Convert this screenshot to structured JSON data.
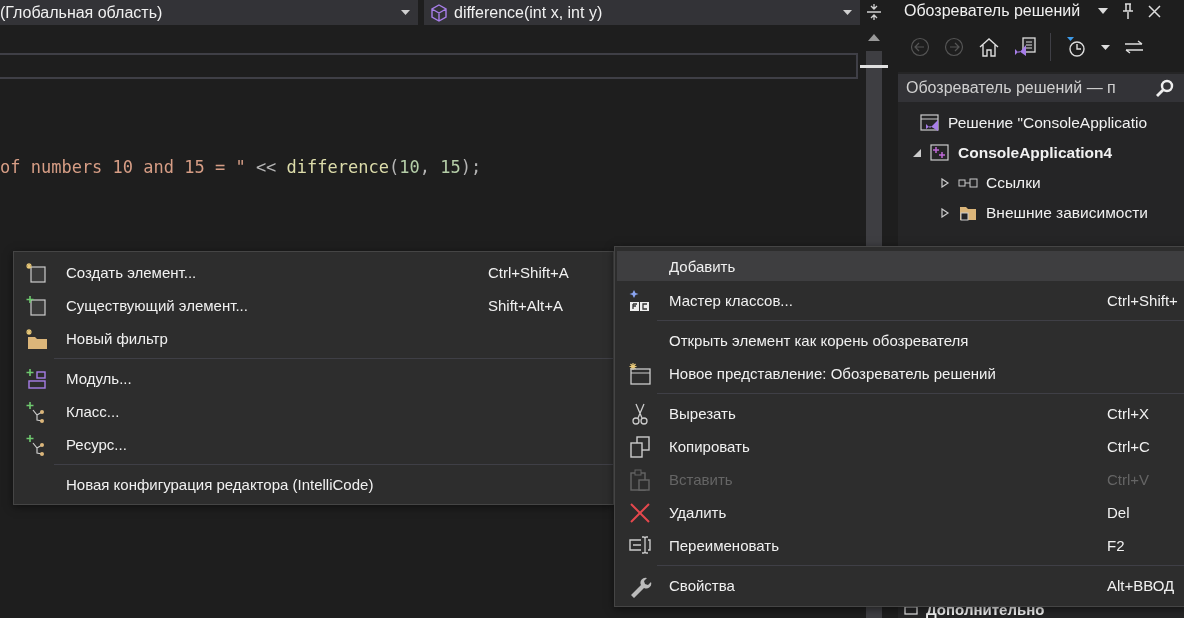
{
  "editor": {
    "scope_dropdown": "(Глобальная область)",
    "member_dropdown": "difference(int x, int y)",
    "code_line": [
      {
        "kind": "string",
        "text": "of numbers 10 and 15 = \""
      },
      {
        "kind": "operator",
        "text": " << "
      },
      {
        "kind": "function",
        "text": "difference"
      },
      {
        "kind": "punct",
        "text": "("
      },
      {
        "kind": "number",
        "text": "10"
      },
      {
        "kind": "punct",
        "text": ", "
      },
      {
        "kind": "number",
        "text": "15"
      },
      {
        "kind": "punct",
        "text": ");"
      }
    ]
  },
  "solution_explorer": {
    "title": "Обозреватель решений",
    "search": {
      "placeholder": "Обозреватель решений — п"
    },
    "tree": [
      {
        "label": "Решение \"ConsoleApplicatio",
        "selected": false,
        "children": [
          {
            "label": "ConsoleApplication4",
            "bold": true,
            "expanded": true,
            "selected": false,
            "children": [
              {
                "label": "Ссылки",
                "expanded": false,
                "selected": false
              },
              {
                "label": "Внешние зависимости",
                "expanded": false,
                "selected": false
              }
            ]
          }
        ]
      }
    ],
    "bottom_section": "Дополнительно"
  },
  "context_menu": [
    {
      "kind": "item",
      "label": "Добавить",
      "selected": true,
      "disabled": false
    },
    {
      "kind": "item",
      "label": "Мастер классов...",
      "shortcut": "Ctrl+Shift+",
      "selected": false,
      "disabled": false
    },
    {
      "kind": "separator"
    },
    {
      "kind": "item",
      "label": "Открыть элемент как корень обозревателя",
      "selected": false,
      "disabled": false
    },
    {
      "kind": "item",
      "label": "Новое представление: Обозреватель решений",
      "selected": false,
      "disabled": false
    },
    {
      "kind": "separator"
    },
    {
      "kind": "item",
      "label": "Вырезать",
      "shortcut": "Ctrl+X",
      "selected": false,
      "disabled": false
    },
    {
      "kind": "item",
      "label": "Копировать",
      "shortcut": "Ctrl+C",
      "selected": false,
      "disabled": false
    },
    {
      "kind": "item",
      "label": "Вставить",
      "shortcut": "Ctrl+V",
      "selected": false,
      "disabled": true
    },
    {
      "kind": "item",
      "label": "Удалить",
      "shortcut": "Del",
      "selected": false,
      "disabled": false
    },
    {
      "kind": "item",
      "label": "Переименовать",
      "shortcut": "F2",
      "selected": false,
      "disabled": false
    },
    {
      "kind": "separator"
    },
    {
      "kind": "item",
      "label": "Свойства",
      "shortcut": "Alt+ВВОД",
      "selected": false,
      "disabled": false
    }
  ],
  "add_submenu": [
    {
      "kind": "item",
      "label": "Создать элемент...",
      "shortcut": "Ctrl+Shift+A",
      "selected": false
    },
    {
      "kind": "item",
      "label": "Существующий элемент...",
      "shortcut": "Shift+Alt+A",
      "selected": false
    },
    {
      "kind": "item",
      "label": "Новый фильтр",
      "selected": false
    },
    {
      "kind": "separator"
    },
    {
      "kind": "item",
      "label": "Модуль...",
      "selected": false
    },
    {
      "kind": "item",
      "label": "Класс...",
      "selected": false
    },
    {
      "kind": "item",
      "label": "Ресурс...",
      "selected": false
    },
    {
      "kind": "separator"
    },
    {
      "kind": "item",
      "label": "Новая конфигурация редактора (IntelliCode)",
      "selected": false
    }
  ]
}
